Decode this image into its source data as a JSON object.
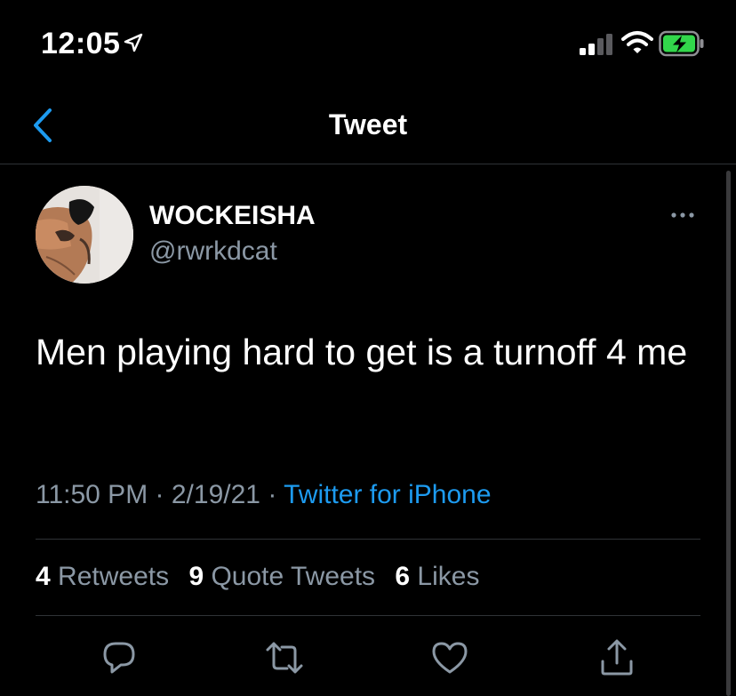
{
  "status_bar": {
    "time": "12:05"
  },
  "nav": {
    "title": "Tweet"
  },
  "tweet": {
    "display_name": "WOCKEISHA",
    "handle": "@rwrkdcat",
    "text": "Men playing hard to get is a turnoff 4 me",
    "time": "11:50 PM",
    "date": "2/19/21",
    "source": "Twitter for iPhone",
    "separator": "·"
  },
  "stats": {
    "retweets_count": "4",
    "retweets_label": "Retweets",
    "quotes_count": "9",
    "quotes_label": "Quote Tweets",
    "likes_count": "6",
    "likes_label": "Likes"
  },
  "colors": {
    "background": "#000000",
    "accent": "#1d9bf0",
    "secondary_text": "#8b98a5",
    "divider": "#2f3336",
    "battery_charging": "#32d74b"
  },
  "icons": {
    "back": "chevron-left-icon",
    "more": "more-horizontal-icon",
    "reply": "reply-icon",
    "retweet": "retweet-icon",
    "like": "heart-icon",
    "share": "share-icon"
  }
}
